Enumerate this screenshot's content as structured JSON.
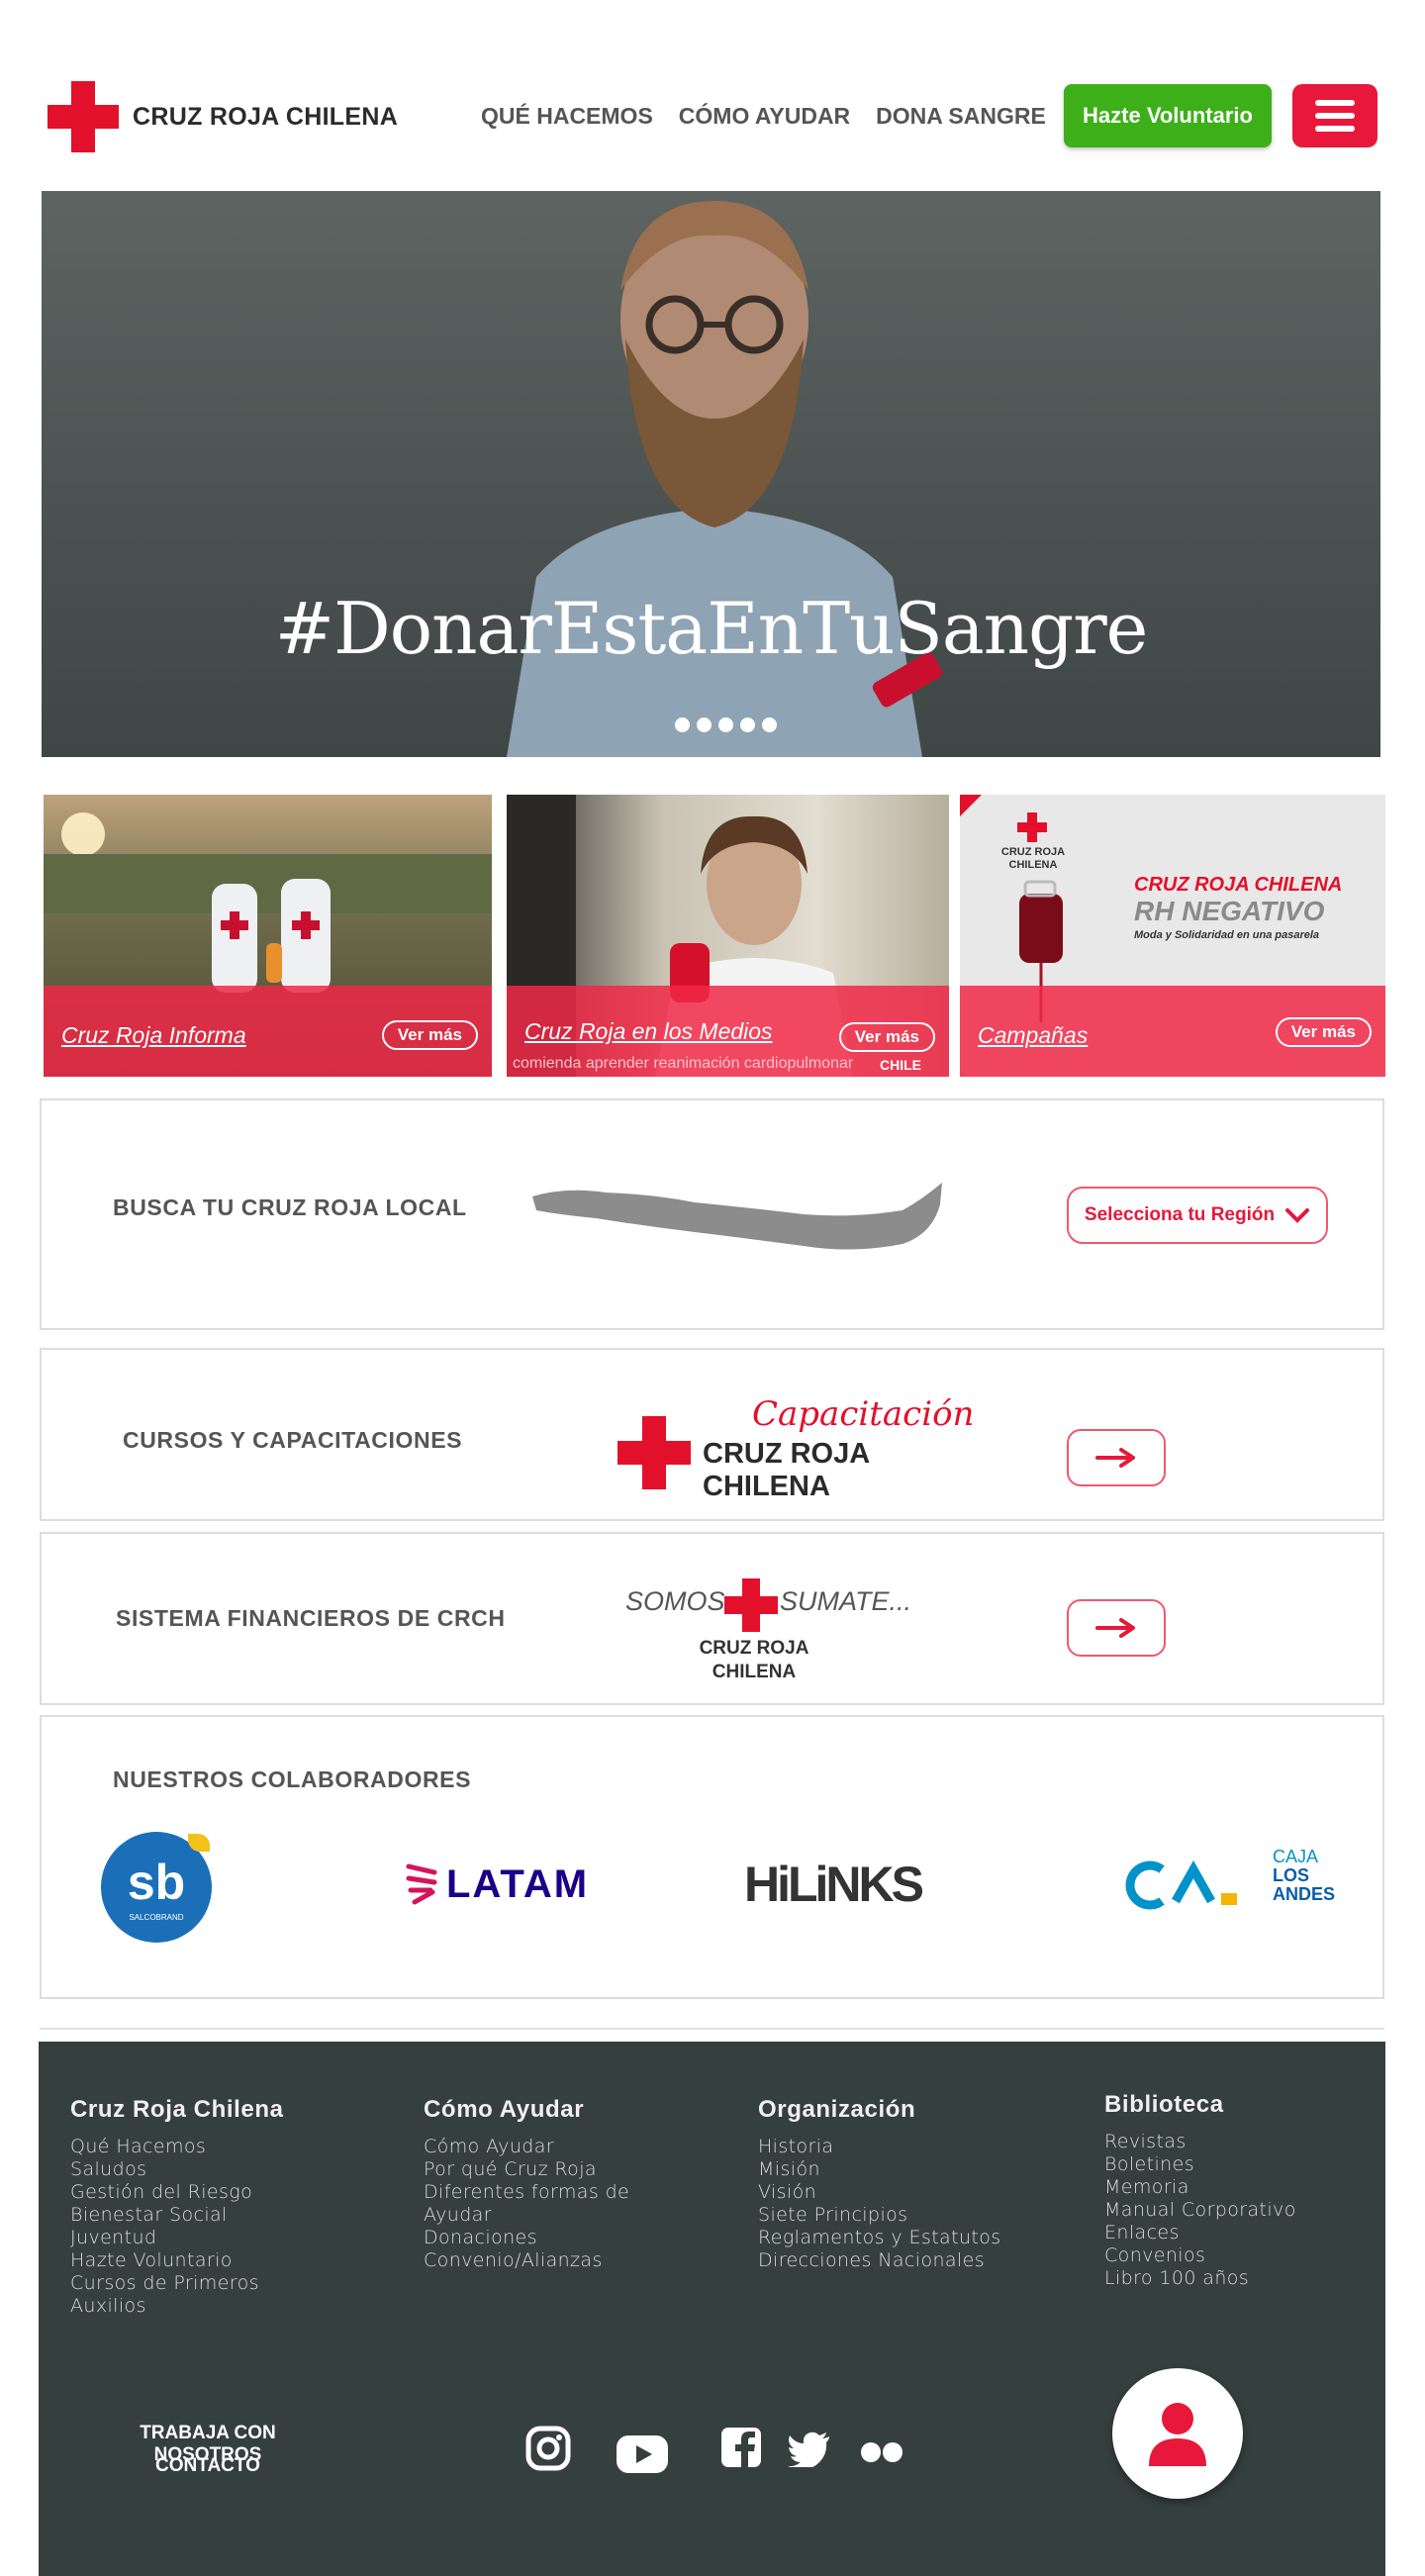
{
  "header": {
    "logo_text": "CRUZ ROJA CHILENA",
    "nav": [
      "QUÉ HACEMOS",
      "CÓMO AYUDAR",
      "DONA SANGRE"
    ],
    "volunteer_button": "Hazte Voluntario"
  },
  "hero": {
    "caption": "#DonarEstaEnTuSangre",
    "slide_count": 5
  },
  "cards": [
    {
      "label": "Cruz Roja Informa",
      "button": "Ver más"
    },
    {
      "label": "Cruz Roja en los Medios",
      "button": "Ver más",
      "overlay_text": "comienda aprender reanimación cardiopulmonar",
      "tag": "CHILE"
    },
    {
      "label": "Campañas",
      "button": "Ver más",
      "poster_title": "CRUZ ROJA CHILENA",
      "poster_subtitle": "RH NEGATIVO",
      "poster_tagline": "Moda y Solidaridad en una pasarela",
      "poster_logo": "CRUZ ROJA CHILENA"
    }
  ],
  "local": {
    "title": "BUSCA TU CRUZ ROJA LOCAL",
    "select_label": "Selecciona tu Región"
  },
  "courses": {
    "title": "CURSOS Y CAPACITACIONES",
    "logo_script": "Capacitación",
    "logo_text": "CRUZ ROJA CHILENA"
  },
  "finance": {
    "title": "SISTEMA FINANCIEROS DE CRCH",
    "logo_left": "SOMOS",
    "logo_right": "SUMATE...",
    "logo_text_1": "CRUZ ROJA",
    "logo_text_2": "CHILENA"
  },
  "partners": {
    "title": "NUESTROS COLABORADORES",
    "logos": [
      "sb",
      "SALCOBRAND",
      "LATAM",
      "HiLiNKS",
      "CAJA",
      "LOS",
      "ANDES"
    ]
  },
  "footer": {
    "columns": [
      {
        "title": "Cruz Roja Chilena",
        "items": [
          "Qué Hacemos",
          "Saludos",
          "Gestión del Riesgo",
          "Bienestar Social",
          "Juventud",
          "Hazte Voluntario",
          "Cursos de Primeros",
          "Auxilios"
        ]
      },
      {
        "title": "Cómo Ayudar",
        "items": [
          "Cómo Ayudar",
          "Por qué Cruz Roja",
          "Diferentes formas de",
          "Ayudar",
          "Donaciones",
          "Convenio/Alianzas"
        ]
      },
      {
        "title": "Organización",
        "items": [
          "Historia",
          "Misión",
          "Visión",
          "Siete Principios",
          "Reglamentos y Estatutos",
          "Direcciones Nacionales"
        ]
      },
      {
        "title": "Biblioteca",
        "items": [
          "Revistas",
          "Boletines",
          "Memoria",
          "Manual Corporativo",
          "Enlaces",
          "Convenios",
          "Libro 100 años"
        ]
      }
    ],
    "work_with_us": "TRABAJA CON NOSOTROS",
    "contact": "CONTACTO",
    "social_icons": [
      "instagram-icon",
      "youtube-icon",
      "facebook-icon",
      "twitter-icon",
      "flickr-icon"
    ]
  },
  "colors": {
    "brand_red": "#e3102b",
    "volunteer_green": "#3db019",
    "footer_bg": "#353f3e",
    "card_overlay": "#f02846"
  }
}
